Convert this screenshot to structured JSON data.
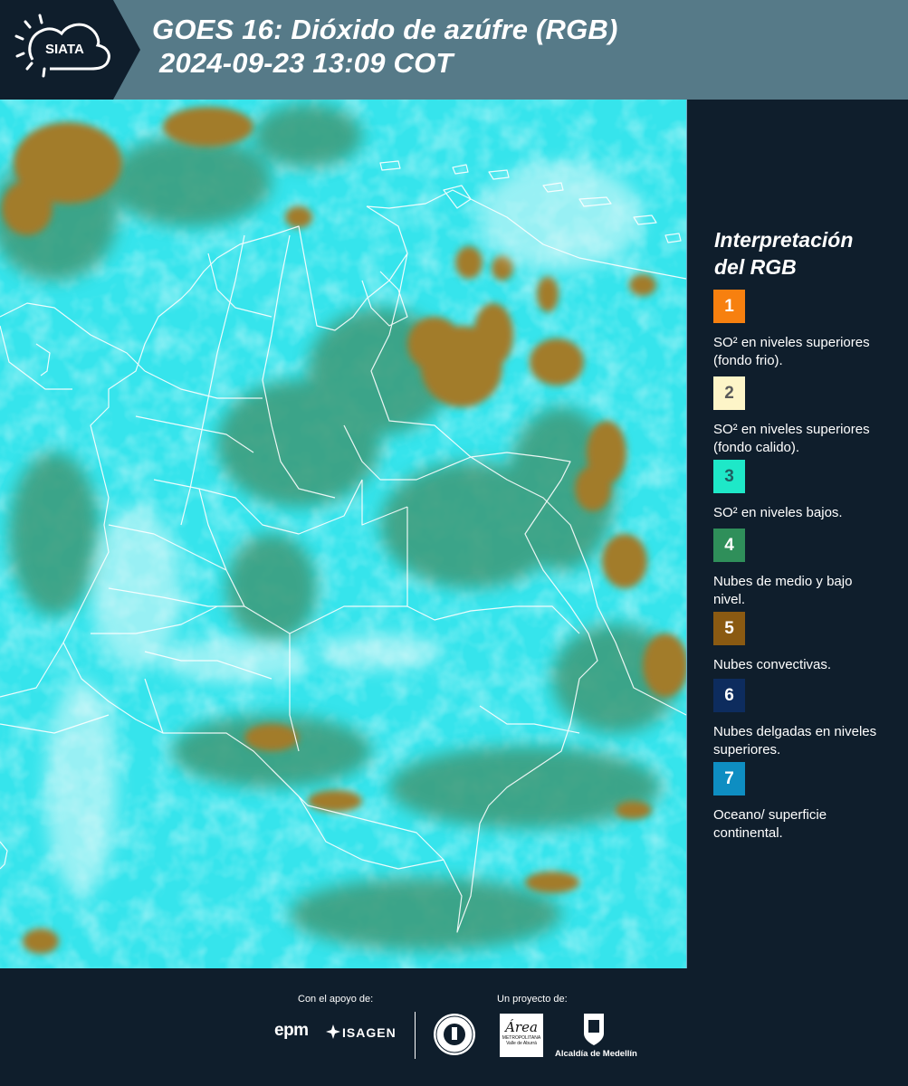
{
  "header": {
    "logo_text": "SIATA",
    "title_line1": "GOES 16: Dióxido de azúfre (RGB)",
    "title_line2": "2024-09-23 13:09 COT",
    "background_color": "#567a88"
  },
  "map": {
    "icon": "satellite-rgb-image",
    "base_color": "#33e3ea",
    "cloud_color": "#a07a28",
    "border_color": "#ffffff"
  },
  "legend": {
    "title_line1": "Interpretación",
    "title_line2": "del RGB",
    "items": [
      {
        "number": "1",
        "color": "#f7800f",
        "label": "SO² en niveles superiores (fondo frio)."
      },
      {
        "number": "2",
        "color": "#fdf5c8",
        "label": "SO² en niveles superiores (fondo calido)."
      },
      {
        "number": "3",
        "color": "#1ee8c8",
        "label": "SO² en niveles bajos."
      },
      {
        "number": "4",
        "color": "#2f8f5a",
        "label": "Nubes de medio y bajo nivel."
      },
      {
        "number": "5",
        "color": "#8a5a12",
        "label": "Nubes convectivas."
      },
      {
        "number": "6",
        "color": "#0d2c5e",
        "label": "Nubes delgadas en niveles superiores."
      },
      {
        "number": "7",
        "color": "#0e8ec2",
        "label": "Oceano/ superficie continental."
      }
    ]
  },
  "footer": {
    "support_label": "Con el apoyo de:",
    "project_label": "Un proyecto de:",
    "sponsor_epm": "epm",
    "sponsor_isagen": "ISAGEN",
    "amva_name": "Área",
    "amva_sub": "METROPOLITANA Valle de Aburrá",
    "alcaldia": "Alcaldía de Medellín"
  }
}
